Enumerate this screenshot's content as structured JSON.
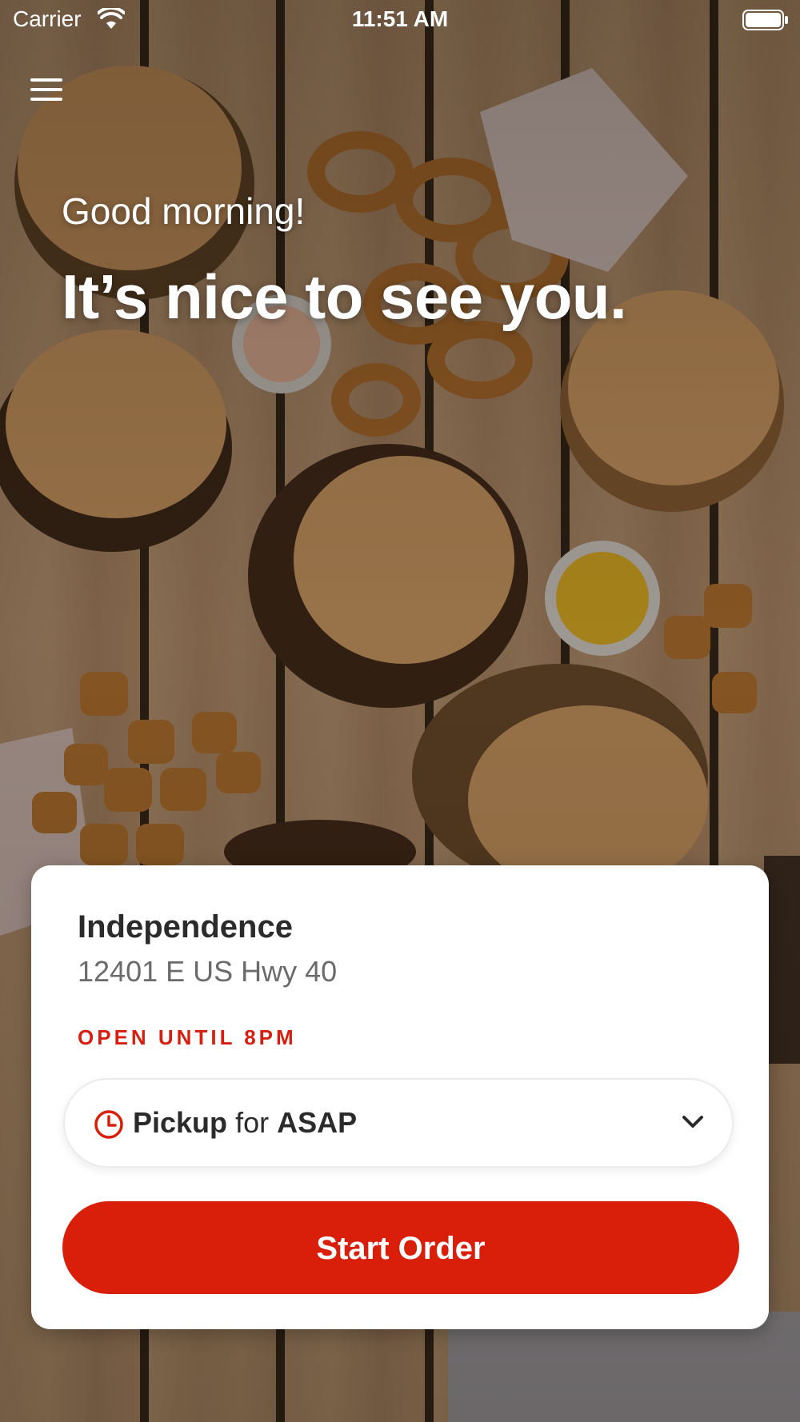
{
  "status_bar": {
    "carrier": "Carrier",
    "time": "11:51 AM",
    "wifi_icon": "wifi-icon",
    "battery_icon": "battery-full-icon"
  },
  "header": {
    "menu_icon": "hamburger-menu-icon"
  },
  "hero": {
    "greeting": "Good morning!",
    "headline": "It’s nice to see you."
  },
  "location_card": {
    "store_name": "Independence",
    "address": "12401 E US Hwy 40",
    "hours": "OPEN UNTIL 8PM",
    "order_type": {
      "icon": "clock-icon",
      "mode": "Pickup",
      "connector": "for",
      "time": "ASAP",
      "dropdown_icon": "chevron-down-icon"
    },
    "start_button_label": "Start Order"
  },
  "colors": {
    "accent_red": "#d91f0a",
    "card_background": "#ffffff",
    "title_text": "#2b2b2b",
    "secondary_text": "#6b6b6b"
  }
}
